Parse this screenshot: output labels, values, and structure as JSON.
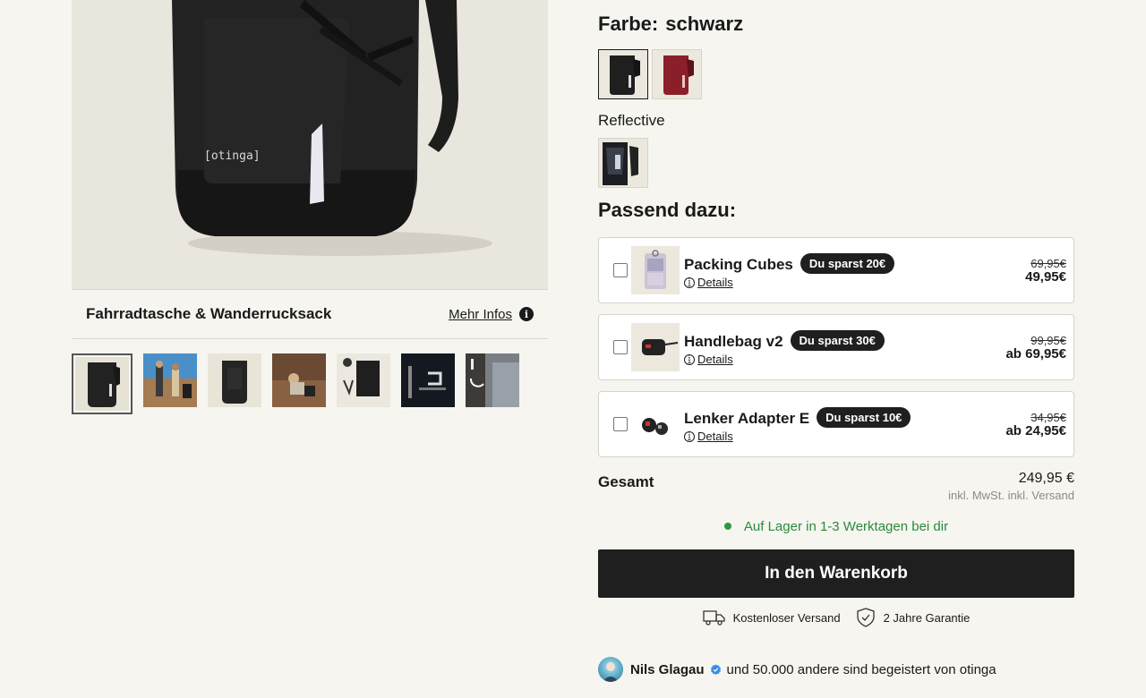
{
  "product": {
    "subtitle": "Fahrradtasche & Wanderrucksack",
    "more_info": "Mehr Infos",
    "logo_text": "[otinga]",
    "thumbnails": [
      "backpack-black",
      "hikers-desert",
      "backpack-front",
      "rocks-sitting",
      "accessories",
      "dark-detail",
      "outdoor-mount"
    ]
  },
  "color": {
    "label": "Farbe:",
    "value": "schwarz",
    "options": [
      "schwarz",
      "rot"
    ],
    "reflective_label": "Reflective"
  },
  "addons": {
    "heading": "Passend dazu:",
    "details_label": "Details",
    "items": [
      {
        "name": "Packing Cubes",
        "badge": "Du sparst 20€",
        "old_price": "69,95€",
        "new_price": "49,95€"
      },
      {
        "name": "Handlebag v2",
        "badge": "Du sparst 30€",
        "old_price": "99,95€",
        "new_price": "ab 69,95€"
      },
      {
        "name": "Lenker Adapter E",
        "badge": "Du sparst 10€",
        "old_price": "34,95€",
        "new_price": "ab 24,95€"
      }
    ]
  },
  "total": {
    "label": "Gesamt",
    "value": "249,95 €",
    "note": "inkl. MwSt. inkl. Versand"
  },
  "stock": {
    "text": "Auf Lager in 1-3 Werktagen bei dir",
    "color": "#2a9a3e"
  },
  "cart_button": "In den Warenkorb",
  "perks": {
    "shipping": "Kostenloser Versand",
    "warranty": "2 Jahre Garantie"
  },
  "social": {
    "name": "Nils Glagau",
    "text": "und 50.000 andere sind begeistert von otinga"
  }
}
